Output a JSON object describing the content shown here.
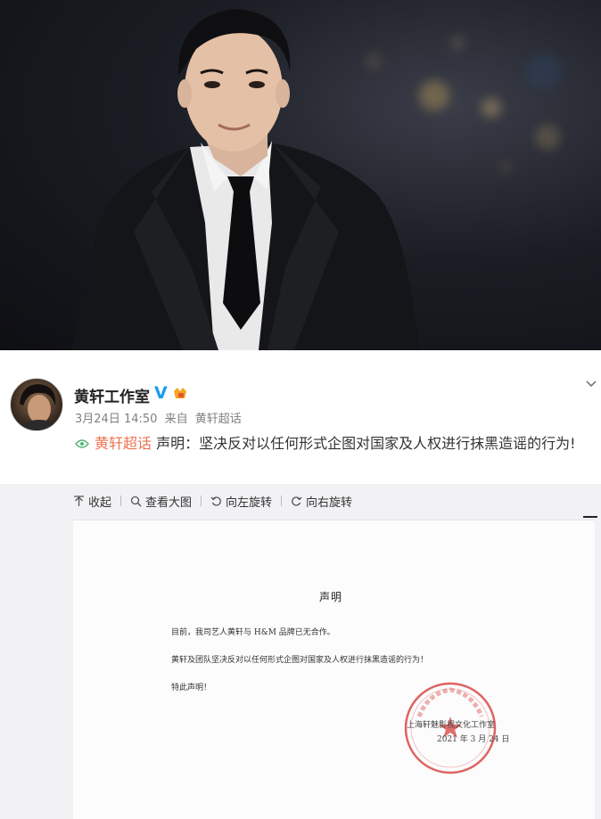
{
  "post": {
    "author": "黄轩工作室",
    "verified_mark": "V",
    "date": "3月24日 14:50",
    "source_prefix": "来自",
    "source": "黄轩超话",
    "topic": "黄轩超话",
    "text": "声明：坚决反对以任何形式企图对国家及人权进行抹黑造谣的行为!"
  },
  "toolbar": {
    "collapse": "收起",
    "view_large": "查看大图",
    "rotate_left": "向左旋转",
    "rotate_right": "向右旋转"
  },
  "document": {
    "title": "声明",
    "line1": "目前，我司艺人黄轩与 H&M 品牌已无合作。",
    "line2": "黄轩及团队坚决反对以任何形式企图对国家及人权进行抹黑造谣的行为！",
    "line3": "特此声明！",
    "company": "上海轩魅影视文化工作室",
    "date": "2021 年 3 月 24 日"
  },
  "colors": {
    "accent": "#eb7350",
    "verified": "#1a9cf0",
    "seal": "#d94848"
  }
}
